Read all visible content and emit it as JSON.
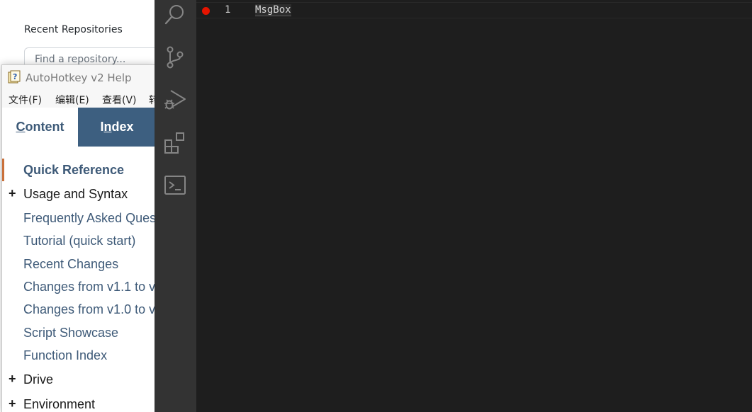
{
  "github_desktop": {
    "recent_heading": "Recent Repositories",
    "search_placeholder": "Find a repository..."
  },
  "help_window": {
    "title": "AutoHotkey v2 Help",
    "menu": [
      "文件(F)",
      "编辑(E)",
      "查看(V)",
      "转"
    ],
    "tabs": {
      "content": {
        "prefix": "",
        "underlined": "C",
        "rest": "ontent"
      },
      "index": {
        "prefix": "I",
        "underlined": "n",
        "rest": "dex"
      }
    },
    "items": [
      {
        "label": "Quick Reference",
        "expandable": false,
        "active": true
      },
      {
        "label": "Usage and Syntax",
        "expandable": true,
        "active": false
      },
      {
        "label": "Frequently Asked Ques",
        "expandable": false,
        "active": false
      },
      {
        "label": "Tutorial (quick start)",
        "expandable": false,
        "active": false
      },
      {
        "label": "Recent Changes",
        "expandable": false,
        "active": false
      },
      {
        "label": "Changes from v1.1 to v",
        "expandable": false,
        "active": false
      },
      {
        "label": "Changes from v1.0 to v",
        "expandable": false,
        "active": false
      },
      {
        "label": "Script Showcase",
        "expandable": false,
        "active": false
      },
      {
        "label": "Function Index",
        "expandable": false,
        "active": false
      },
      {
        "label": "Drive",
        "expandable": true,
        "active": false
      },
      {
        "label": "Environment",
        "expandable": true,
        "active": false
      }
    ],
    "expand_symbol": "+"
  },
  "activity_bar": {
    "icons": [
      "search-icon",
      "source-control-icon",
      "run-debug-icon",
      "extensions-icon",
      "terminal-icon"
    ]
  },
  "editor": {
    "line_number": "1",
    "code": "MsgBox",
    "breakpoint_color": "#e51400"
  }
}
